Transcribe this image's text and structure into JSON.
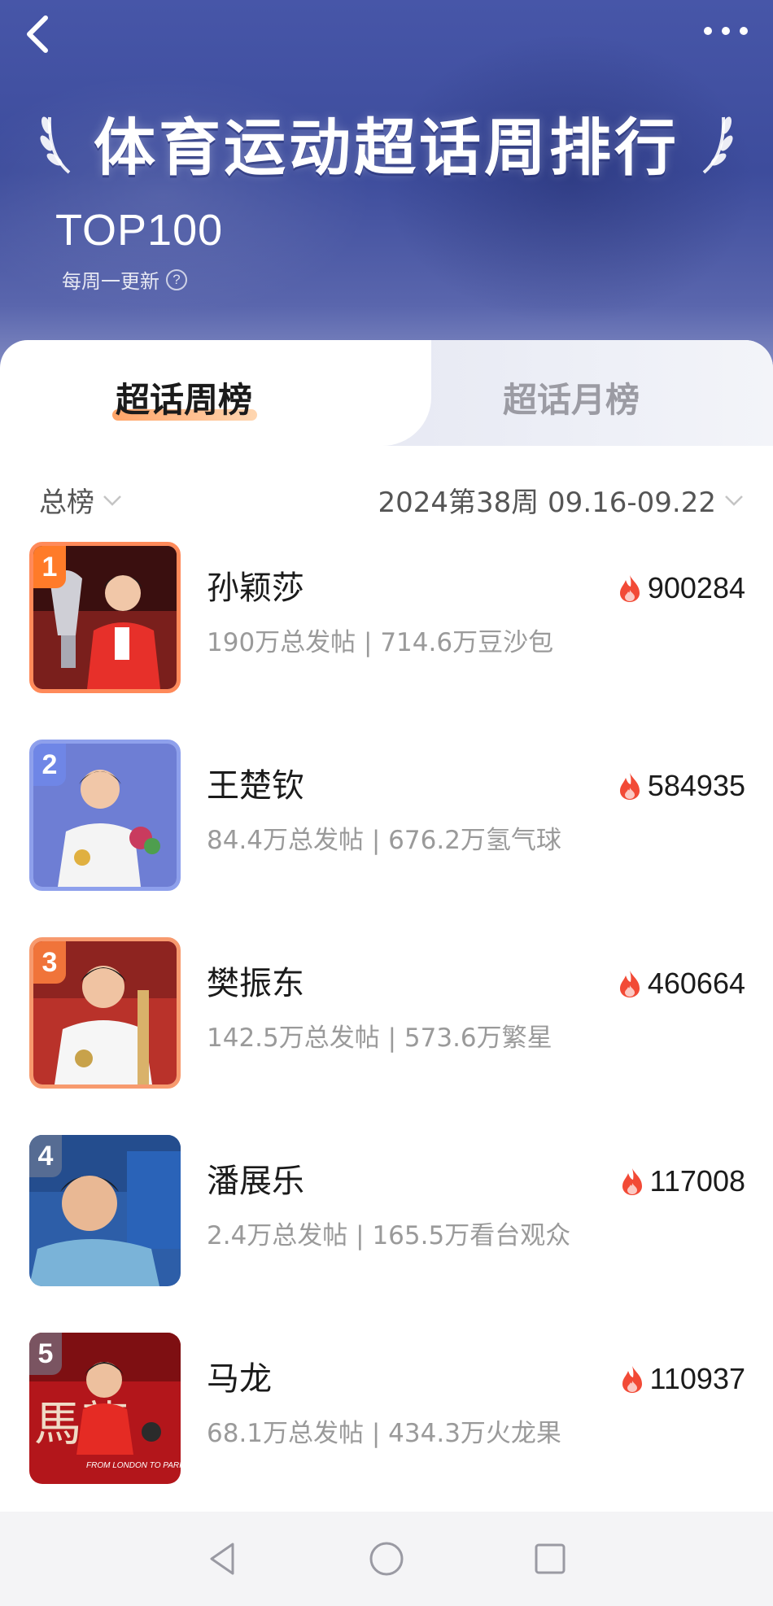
{
  "header": {
    "title": "体育运动超话周排行",
    "top_label": "TOP100",
    "update_text": "每周一更新",
    "help_icon": "question-circle-icon",
    "back_icon": "chevron-left-icon",
    "more_icon": "more-dots-icon"
  },
  "tabs": [
    {
      "label": "超话周榜",
      "active": true
    },
    {
      "label": "超话月榜",
      "active": false
    }
  ],
  "filters": {
    "category": "总榜",
    "period": "2024第38周 09.16-09.22"
  },
  "rankings": [
    {
      "rank": "1",
      "name": "孙颖莎",
      "stats": "190万总发帖 | 714.6万豆沙包",
      "heat": "900284"
    },
    {
      "rank": "2",
      "name": "王楚钦",
      "stats": "84.4万总发帖 | 676.2万氢气球",
      "heat": "584935"
    },
    {
      "rank": "3",
      "name": "樊振东",
      "stats": "142.5万总发帖 | 573.6万繁星",
      "heat": "460664"
    },
    {
      "rank": "4",
      "name": "潘展乐",
      "stats": "2.4万总发帖 | 165.5万看台观众",
      "heat": "117008"
    },
    {
      "rank": "5",
      "name": "马龙",
      "stats": "68.1万总发帖 | 434.3万火龙果",
      "heat": "110937"
    }
  ],
  "thumb_texts": {
    "r5_chars": "馬龍",
    "r5_caption": "FROM LONDON TO PARIS"
  },
  "colors": {
    "header_bg": "#4756a8",
    "accent_orange": "#ff7b29",
    "flame_red": "#f24a36",
    "text_primary": "#1b1b1b",
    "text_secondary": "#9a9a9a"
  },
  "nav": {
    "back_icon": "triangle-back-icon",
    "home_icon": "circle-home-icon",
    "recent_icon": "square-recent-icon"
  }
}
